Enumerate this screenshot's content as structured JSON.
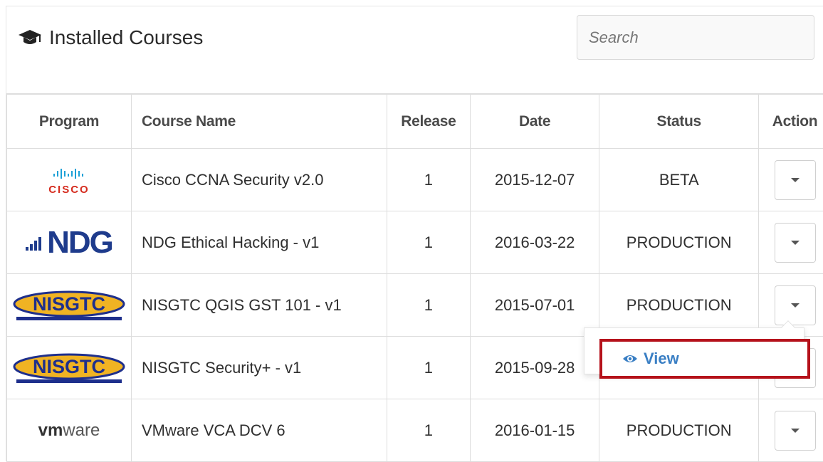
{
  "panel": {
    "title": "Installed Courses",
    "title_icon": "graduation-cap-icon",
    "search_placeholder": "Search"
  },
  "table": {
    "headers": [
      "Program",
      "Course Name",
      "Release",
      "Date",
      "Status",
      "Action"
    ],
    "rows": [
      {
        "program": "cisco",
        "logo_text": "CISCO",
        "course": "Cisco CCNA Security v2.0",
        "release": "1",
        "date": "2015-12-07",
        "status": "BETA"
      },
      {
        "program": "ndg",
        "logo_text": "NDG",
        "course": "NDG Ethical Hacking - v1",
        "release": "1",
        "date": "2016-03-22",
        "status": "PRODUCTION"
      },
      {
        "program": "nisgtc",
        "logo_text": "NISGTC",
        "course": "NISGTC QGIS GST 101 - v1",
        "release": "1",
        "date": "2015-07-01",
        "status": "PRODUCTION"
      },
      {
        "program": "nisgtc",
        "logo_text": "NISGTC",
        "course": "NISGTC Security+ - v1",
        "release": "1",
        "date": "2015-09-28",
        "status": ""
      },
      {
        "program": "vmware",
        "logo_text": "vmware",
        "course": "VMware VCA DCV 6",
        "release": "1",
        "date": "2016-01-15",
        "status": "PRODUCTION"
      }
    ]
  },
  "dropdown": {
    "items": [
      {
        "label": "View",
        "icon": "eye-icon"
      }
    ]
  },
  "colors": {
    "highlight_border": "#b5121b",
    "link": "#3a7fc4",
    "cisco_red": "#d52b1e",
    "ndg_blue": "#1e3b8c",
    "nisgtc_gold": "#f0b323"
  }
}
